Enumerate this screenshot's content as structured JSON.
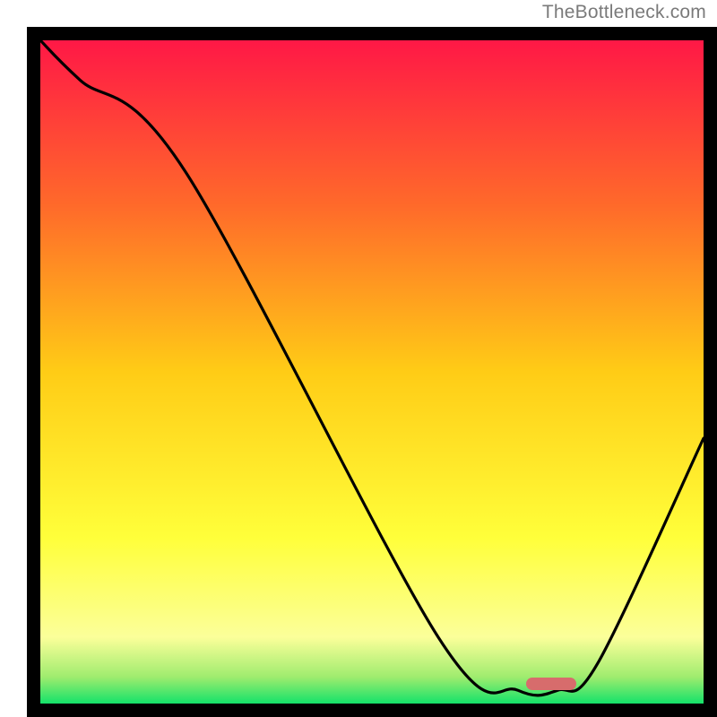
{
  "watermark": "TheBottleneck.com",
  "chart_data": {
    "type": "line",
    "title": "",
    "xlabel": "",
    "ylabel": "",
    "xlim": [
      0,
      100
    ],
    "ylim": [
      0,
      100
    ],
    "background": {
      "kind": "vertical-gradient",
      "stops": [
        {
          "y_pct": 0,
          "color": "#ff1846"
        },
        {
          "y_pct": 25,
          "color": "#ff6a2a"
        },
        {
          "y_pct": 50,
          "color": "#ffcc16"
        },
        {
          "y_pct": 75,
          "color": "#ffff3a"
        },
        {
          "y_pct": 90,
          "color": "#fbff9a"
        },
        {
          "y_pct": 96,
          "color": "#9fec6e"
        },
        {
          "y_pct": 100,
          "color": "#14e26a"
        }
      ]
    },
    "series": [
      {
        "name": "bottleneck-curve",
        "color": "#000000",
        "x": [
          0,
          6,
          22,
          60,
          72,
          78,
          84,
          100
        ],
        "y": [
          100,
          94,
          80,
          10,
          2,
          2,
          6,
          40
        ]
      }
    ],
    "marker": {
      "x_center_pct": 77,
      "y_pct": 3,
      "color": "#d76c6c",
      "shape": "rounded-bar"
    }
  }
}
